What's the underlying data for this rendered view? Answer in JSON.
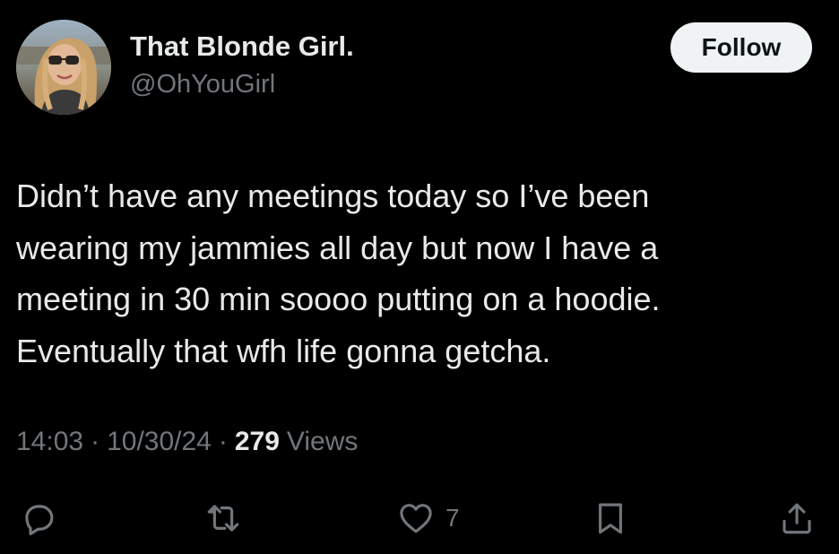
{
  "author": {
    "display_name": "That Blonde Girl.",
    "handle": "@OhYouGirl"
  },
  "follow_button": {
    "label": "Follow"
  },
  "tweet": {
    "lines": [
      "Didn’t have any meetings today so I’ve been",
      "wearing my jammies all day but now I have a",
      "meeting in 30 min soooo putting on a hoodie.",
      "Eventually that wfh life gonna getcha."
    ]
  },
  "meta": {
    "time": "14:03",
    "separator": "·",
    "date": "10/30/24",
    "views_count": "279",
    "views_label": "Views"
  },
  "actions": {
    "reply_icon": "reply-icon",
    "retweet_icon": "retweet-icon",
    "like_icon": "heart-icon",
    "like_count": "7",
    "bookmark_icon": "bookmark-icon",
    "share_icon": "share-icon"
  },
  "colors": {
    "background": "#000000",
    "text_primary": "#e7e9ea",
    "text_secondary": "#71767b",
    "button_bg": "#eff3f4"
  }
}
